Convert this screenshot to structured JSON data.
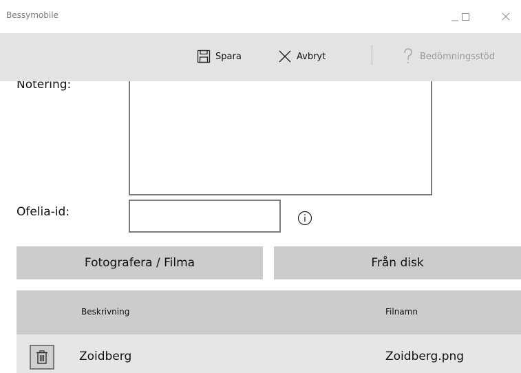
{
  "window": {
    "title": "Bessymobile"
  },
  "toolbar": {
    "save_label": "Spara",
    "cancel_label": "Avbryt",
    "help_label": "Bedömningsstöd"
  },
  "form": {
    "note_label": "Notering:",
    "note_value": "",
    "ofelia_label": "Ofelia-id:",
    "ofelia_value": ""
  },
  "buttons": {
    "photo_label": "Fotografera / Filma",
    "disk_label": "Från disk"
  },
  "grid": {
    "headers": [
      "Beskrivning",
      "Filnamn"
    ],
    "rows": [
      {
        "description": "Zoidberg",
        "filename": "Zoidberg.png"
      }
    ]
  },
  "icons": [
    "minimize-icon",
    "maximize-icon",
    "close-icon",
    "save-icon",
    "cancel-icon",
    "help-icon",
    "info-icon",
    "trash-icon"
  ]
}
